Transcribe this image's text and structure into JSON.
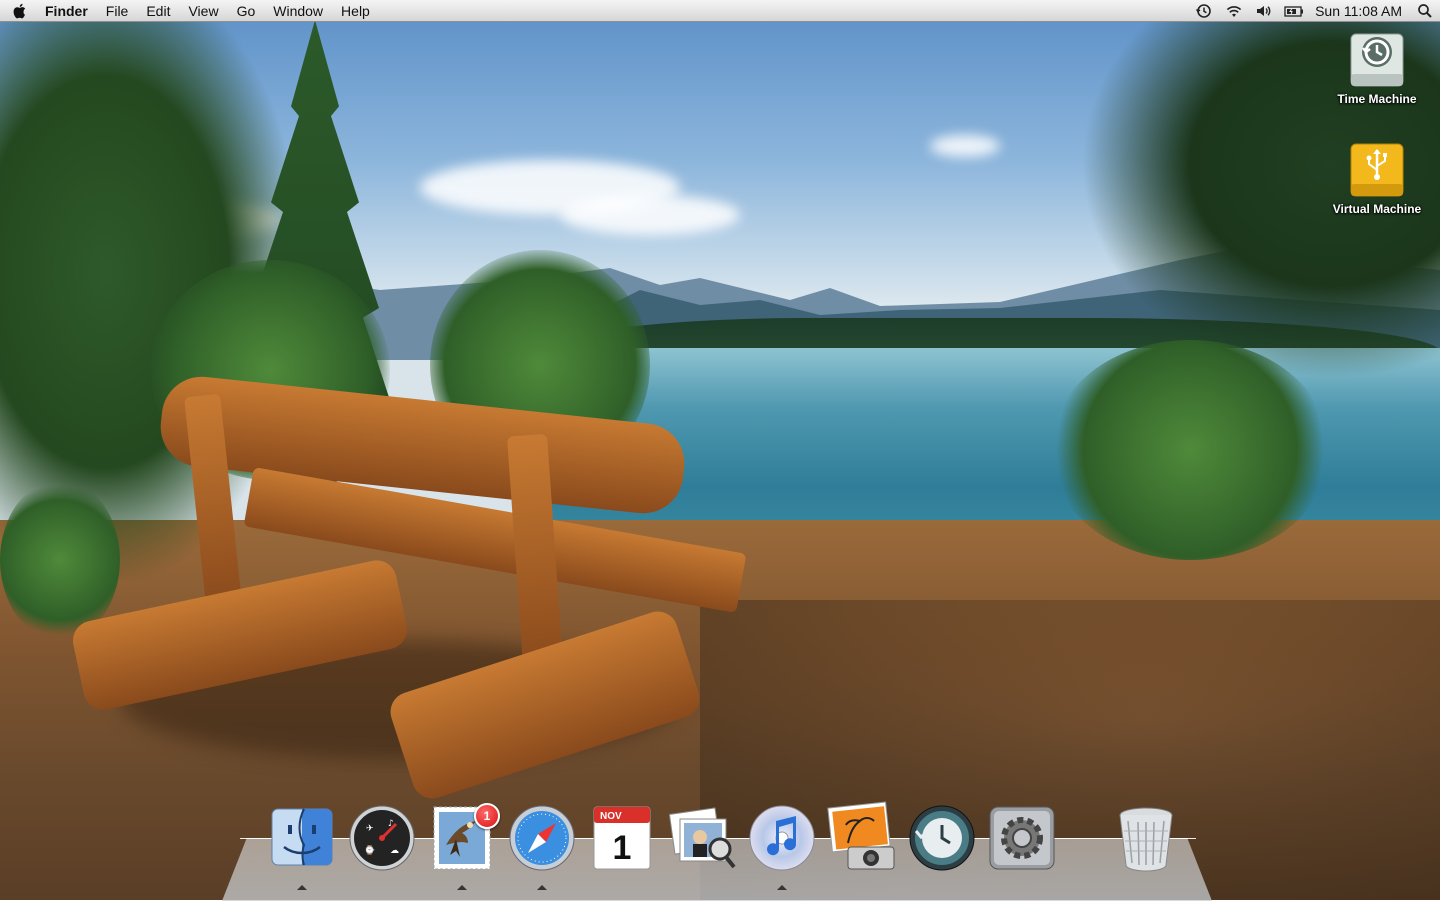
{
  "menubar": {
    "apple_icon": "apple-logo-icon",
    "items": [
      {
        "label": "Finder",
        "is_app": true
      },
      {
        "label": "File"
      },
      {
        "label": "Edit"
      },
      {
        "label": "View"
      },
      {
        "label": "Go"
      },
      {
        "label": "Window"
      },
      {
        "label": "Help"
      }
    ],
    "status": {
      "icons": [
        "time-machine-icon",
        "wifi-icon",
        "volume-icon",
        "battery-icon"
      ],
      "clock": "Sun 11:08 AM",
      "spotlight_icon": "spotlight-search-icon"
    }
  },
  "desktop": {
    "icons": [
      {
        "label": "Time Machine",
        "icon": "time-machine-drive-icon",
        "color": "#dfe7e3"
      },
      {
        "label": "Virtual Machine",
        "icon": "usb-drive-icon",
        "color": "#f2b81c"
      }
    ]
  },
  "dock": {
    "items": [
      {
        "icon": "finder-icon",
        "running": true
      },
      {
        "icon": "dashboard-icon",
        "running": false
      },
      {
        "icon": "mail-icon",
        "running": true,
        "badge": "1"
      },
      {
        "icon": "safari-icon",
        "running": true
      },
      {
        "icon": "ical-icon",
        "running": false,
        "month": "NOV",
        "day": "1"
      },
      {
        "icon": "preview-icon",
        "running": false
      },
      {
        "icon": "itunes-icon",
        "running": true
      },
      {
        "icon": "iphoto-icon",
        "running": false
      },
      {
        "icon": "time-machine-icon",
        "running": false
      },
      {
        "icon": "system-preferences-icon",
        "running": false
      },
      {
        "icon": "trash-icon",
        "running": false
      }
    ]
  }
}
